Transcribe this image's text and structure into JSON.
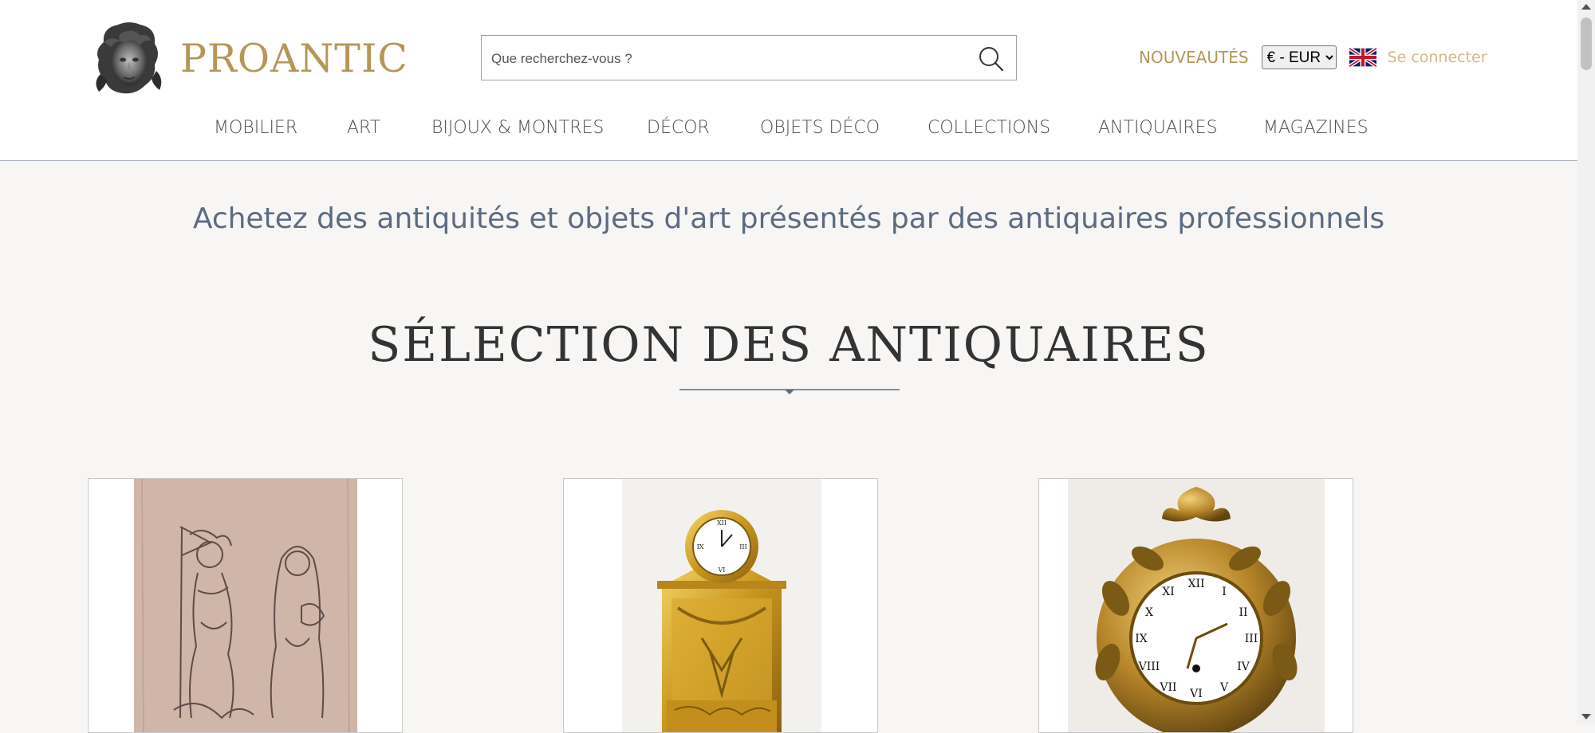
{
  "header": {
    "logo_text": "PROANTIC",
    "search_placeholder": "Que recherchez-vous ?",
    "news_label": "NOUVEAUTÉS",
    "currency_selected": "€ - EUR",
    "login_label": "Se connecter"
  },
  "nav": {
    "items": [
      "MOBILIER",
      "ART",
      "BIJOUX & MONTRES",
      "DÉCOR",
      "OBJETS DÉCO",
      "COLLECTIONS",
      "ANTIQUAIRES",
      "MAGAZINES"
    ]
  },
  "main": {
    "tagline": "Achetez des antiquités et objets d'art présentés par des antiquaires professionnels",
    "section_title": "SÉLECTION DES ANTIQUAIRES"
  },
  "colors": {
    "brand_gold": "#b69655",
    "tagline_blue": "#5b6b80",
    "background": "#f7f6f4"
  },
  "icons": {
    "search": "search-icon",
    "flag": "uk-flag-icon",
    "logo": "logo-head-icon"
  }
}
